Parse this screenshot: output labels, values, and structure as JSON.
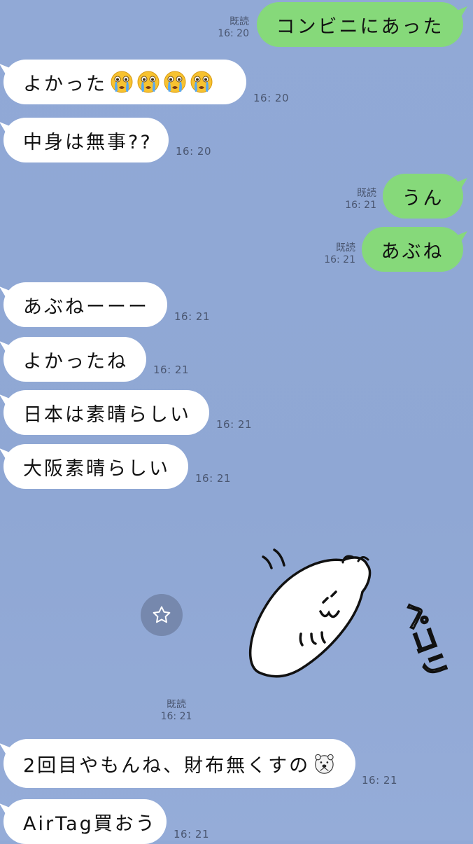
{
  "messages": [
    {
      "side": "out",
      "text": "コンビニにあった",
      "read": "既読",
      "time": "16: 20"
    },
    {
      "side": "in",
      "text": "よかった",
      "emoji": [
        "crying-face-icon",
        "crying-face-icon",
        "crying-face-icon",
        "crying-face-icon"
      ],
      "time": "16: 20"
    },
    {
      "side": "in",
      "text": "中身は無事??",
      "time": "16: 20"
    },
    {
      "side": "out",
      "text": "うん",
      "read": "既読",
      "time": "16: 21"
    },
    {
      "side": "out",
      "text": "あぶね",
      "read": "既読",
      "time": "16: 21"
    },
    {
      "side": "in",
      "text": "あぶねーーー",
      "time": "16: 21"
    },
    {
      "side": "in",
      "text": "よかったね",
      "time": "16: 21"
    },
    {
      "side": "in",
      "text": "日本は素晴らしい",
      "time": "16: 21"
    },
    {
      "side": "in",
      "text": "大阪素晴らしい",
      "time": "16: 21"
    },
    {
      "side": "in",
      "text": "2回目やもんね、財布無くすの",
      "time": "16: 21"
    },
    {
      "side": "in",
      "text": "AirTag買おう",
      "time": "16: 21"
    }
  ],
  "sticker": {
    "read": "既読",
    "time": "16: 21",
    "caption": "ペコリ"
  },
  "colors": {
    "background": "#91a9d6",
    "bubble_in": "#ffffff",
    "bubble_out": "#86d97a"
  }
}
